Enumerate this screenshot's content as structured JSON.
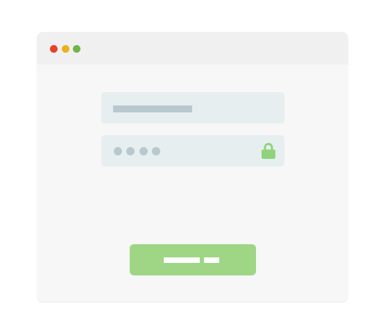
{
  "window": {
    "background": "#f7f7f7",
    "titlebar_background": "#f0f0f0",
    "controls": [
      {
        "name": "close",
        "color": "#e8402a"
      },
      {
        "name": "minimize",
        "color": "#e8b21f"
      },
      {
        "name": "maximize",
        "color": "#70b54a"
      }
    ]
  },
  "login_form": {
    "username_field": {
      "background": "#e7eef0",
      "placeholder_color": "#b7c9cf",
      "value": ""
    },
    "password_field": {
      "background": "#e7eef0",
      "masked_characters": 4,
      "mask_color": "#b7c9cf",
      "icon": "lock-icon",
      "icon_color": "#8fd47b"
    },
    "submit_button": {
      "background": "#9ed685",
      "label_color": "#ffffff"
    }
  }
}
